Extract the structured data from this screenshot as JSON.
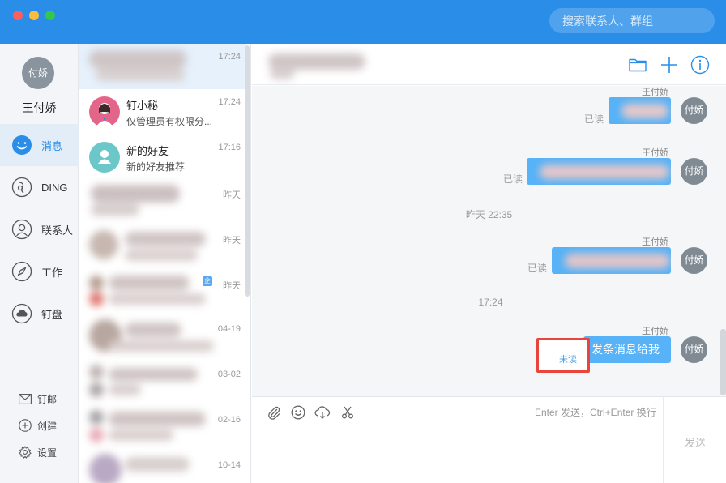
{
  "search": {
    "placeholder": "搜索联系人、群组"
  },
  "user": {
    "avatar_text": "付娇",
    "name": "王付娇"
  },
  "nav": [
    {
      "label": "消息",
      "icon": "smile-icon",
      "active": true
    },
    {
      "label": "DING",
      "icon": "ding-icon"
    },
    {
      "label": "联系人",
      "icon": "contacts-icon"
    },
    {
      "label": "工作",
      "icon": "compass-icon"
    },
    {
      "label": "钉盘",
      "icon": "cloud-disk-icon"
    }
  ],
  "nav_bottom": [
    {
      "label": "钉邮",
      "icon": "mail-icon"
    },
    {
      "label": "创建",
      "icon": "plus-circle-icon"
    },
    {
      "label": "设置",
      "icon": "gear-icon"
    }
  ],
  "conversations": [
    {
      "name": "",
      "preview": "",
      "time": "17:24",
      "blurred": true
    },
    {
      "name": "钉小秘",
      "preview": "仅管理员有权限分...",
      "time": "17:24"
    },
    {
      "name": "新的好友",
      "preview": "新的好友推荐",
      "time": "17:16"
    },
    {
      "name": "",
      "preview": "",
      "time": "昨天",
      "blurred": true
    },
    {
      "name": "",
      "preview": "",
      "time": "昨天",
      "blurred": true
    },
    {
      "name": "",
      "preview": "",
      "time": "昨天",
      "blurred": true,
      "badge": "企"
    },
    {
      "name": "",
      "preview": "",
      "time": "04-19",
      "blurred": true
    },
    {
      "name": "",
      "preview": "",
      "time": "03-02",
      "blurred": true
    },
    {
      "name": "",
      "preview": "",
      "time": "02-16",
      "blurred": true
    },
    {
      "name": "",
      "preview": "",
      "time": "10-14",
      "blurred": true
    }
  ],
  "chat": {
    "messages": [
      {
        "sender": "王付娇",
        "avatar": "付娇",
        "status": "已读",
        "text": "",
        "blurred": true
      },
      {
        "sender": "王付娇",
        "avatar": "付娇",
        "status": "已读",
        "text": "",
        "blurred": true
      },
      {
        "separator": "昨天 22:35"
      },
      {
        "sender": "王付娇",
        "avatar": "付娇",
        "status": "已读",
        "text": "",
        "blurred": true
      },
      {
        "separator": "17:24"
      },
      {
        "sender": "王付娇",
        "avatar": "付娇",
        "status": "未读",
        "text": "发条消息给我",
        "blurred": false,
        "highlighted": true
      }
    ],
    "input_hint": "Enter 发送，Ctrl+Enter 换行",
    "send_label": "发送",
    "tools": [
      "paperclip-icon",
      "emoji-icon",
      "cloud-upload-icon",
      "scissors-icon"
    ]
  },
  "colors": {
    "titlebar": "#2a8ee8",
    "bubble": "#57b2f7",
    "highlight": "#e8453c"
  }
}
